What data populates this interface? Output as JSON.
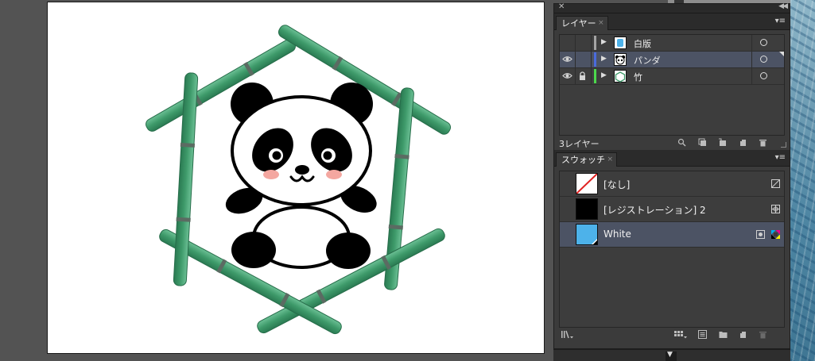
{
  "canvas": {
    "background": "#535353",
    "artboard_color": "#ffffff"
  },
  "colors": {
    "bamboo": "#3e9a6a",
    "bamboo_dark": "#2a7a52",
    "panda_black": "#000000",
    "cheek": "#f4a7a0",
    "selected_row": "#4c5364",
    "swatch_white": "#4db2ea"
  },
  "layers_panel": {
    "tab_label": "レイヤー",
    "footer_count": "3レイヤー",
    "layers": [
      {
        "name": "白版",
        "color": "#a3a3a3",
        "visible": false,
        "locked": false,
        "selected": false,
        "thumb": "blue-rectangle"
      },
      {
        "name": "パンダ",
        "color": "#4a6bdd",
        "visible": true,
        "locked": false,
        "selected": true,
        "thumb": "panda"
      },
      {
        "name": "竹",
        "color": "#4cd84c",
        "visible": true,
        "locked": true,
        "selected": false,
        "thumb": "bamboo-hexagon"
      }
    ],
    "footer_icons": [
      "search-icon",
      "clipping-mask-icon",
      "new-sublayer-icon",
      "new-layer-icon",
      "trash-icon"
    ]
  },
  "swatches_panel": {
    "tab_label": "スウォッチ",
    "swatches": [
      {
        "name": "[なし]",
        "chip": "none",
        "type_icon": "none-swatch-icon",
        "selected": false
      },
      {
        "name": "[レジストレーション] 2",
        "chip": "#000000",
        "type_icon": "registration-icon",
        "selected": false
      },
      {
        "name": "White",
        "chip": "#4db2ea",
        "type_icon": "cmyk-icon",
        "mode_icon": "spot-color-icon",
        "selected": true
      }
    ],
    "footer_icons": [
      "swatch-library-icon",
      "show-kinds-icon",
      "swatch-options-icon",
      "new-color-group-icon",
      "new-swatch-icon",
      "trash-icon"
    ]
  }
}
